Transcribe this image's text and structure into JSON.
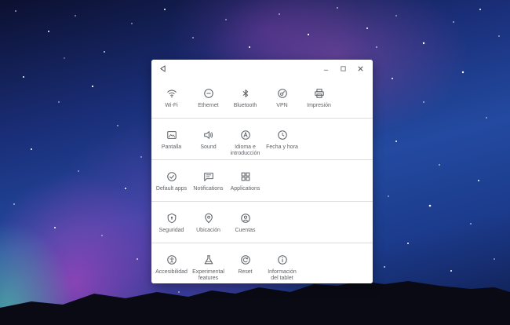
{
  "window": {
    "sections": [
      {
        "items": [
          {
            "label": "Wi-Fi",
            "icon": "wifi-icon"
          },
          {
            "label": "Ethernet",
            "icon": "ethernet-icon"
          },
          {
            "label": "Bluetooth",
            "icon": "bluetooth-icon"
          },
          {
            "label": "VPN",
            "icon": "vpn-icon"
          },
          {
            "label": "Impresión",
            "icon": "printer-icon"
          }
        ]
      },
      {
        "items": [
          {
            "label": "Pantalla",
            "icon": "display-icon"
          },
          {
            "label": "Sound",
            "icon": "speaker-icon"
          },
          {
            "label": "Idioma e\nintroducción",
            "icon": "language-icon"
          },
          {
            "label": "Fecha y hora",
            "icon": "clock-icon"
          }
        ]
      },
      {
        "items": [
          {
            "label": "Default apps",
            "icon": "check-circle-icon"
          },
          {
            "label": "Notifications",
            "icon": "message-icon"
          },
          {
            "label": "Applications",
            "icon": "apps-grid-icon"
          }
        ]
      },
      {
        "items": [
          {
            "label": "Seguridad",
            "icon": "shield-icon"
          },
          {
            "label": "Ubicación",
            "icon": "location-pin-icon"
          },
          {
            "label": "Cuentas",
            "icon": "account-icon"
          }
        ]
      },
      {
        "items": [
          {
            "label": "Accesibilidad",
            "icon": "accessibility-icon"
          },
          {
            "label": "Experimental\nfeatures",
            "icon": "flask-icon"
          },
          {
            "label": "Reset",
            "icon": "reset-icon"
          },
          {
            "label": "Información\ndel tablet",
            "icon": "info-icon"
          }
        ]
      }
    ]
  }
}
